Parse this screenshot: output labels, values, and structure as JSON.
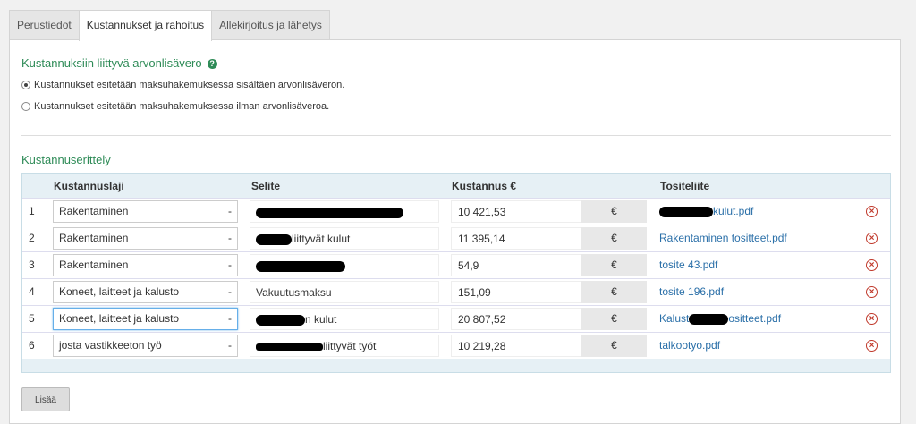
{
  "tabs": [
    "Perustiedot",
    "Kustannukset ja rahoitus",
    "Allekirjoitus ja lähetys"
  ],
  "vat": {
    "heading": "Kustannuksiin liittyvä arvonlisävero",
    "option_with": "Kustannukset esitetään maksuhakemuksessa sisältäen arvonlisäveron.",
    "option_without": "Kustannukset esitetään maksuhakemuksessa ilman arvonlisäveroa.",
    "selected": "with"
  },
  "breakdown": {
    "heading": "Kustannuserittely",
    "columns": {
      "type": "Kustannuslaji",
      "desc": "Selite",
      "cost": "Kustannus €",
      "attachment": "Tositeliite"
    },
    "rows": [
      {
        "num": "1",
        "type": "Rakentaminen",
        "desc_suffix": "",
        "amount": "10 421,53",
        "currency": "€",
        "file_suffix": "kulut.pdf",
        "file_redacted": true
      },
      {
        "num": "2",
        "type": "Rakentaminen",
        "desc_suffix": "liittyvät kulut",
        "amount": "11 395,14",
        "currency": "€",
        "file_suffix": "Rakentaminen tositteet.pdf",
        "file_redacted": false
      },
      {
        "num": "3",
        "type": "Rakentaminen",
        "desc_suffix": "",
        "amount": "54,9",
        "currency": "€",
        "file_suffix": "tosite 43.pdf",
        "file_redacted": false
      },
      {
        "num": "4",
        "type": "Koneet, laitteet ja kalusto",
        "desc_suffix": "Vakuutusmaksu",
        "amount": "151,09",
        "currency": "€",
        "file_suffix": "tosite 196.pdf",
        "file_redacted": false
      },
      {
        "num": "5",
        "type": "Koneet, laitteet ja kalusto",
        "desc_suffix": "n kulut",
        "amount": "20 807,52",
        "currency": "€",
        "file_prefix": "Kalust",
        "file_suffix": "ositteet.pdf",
        "file_redacted": true
      },
      {
        "num": "6",
        "type": "josta vastikkeeton työ",
        "desc_suffix": "liittyvät työt",
        "amount": "10 219,28",
        "currency": "€",
        "file_suffix": "talkootyo.pdf",
        "file_redacted": false
      }
    ]
  },
  "add_button": "Lisää"
}
